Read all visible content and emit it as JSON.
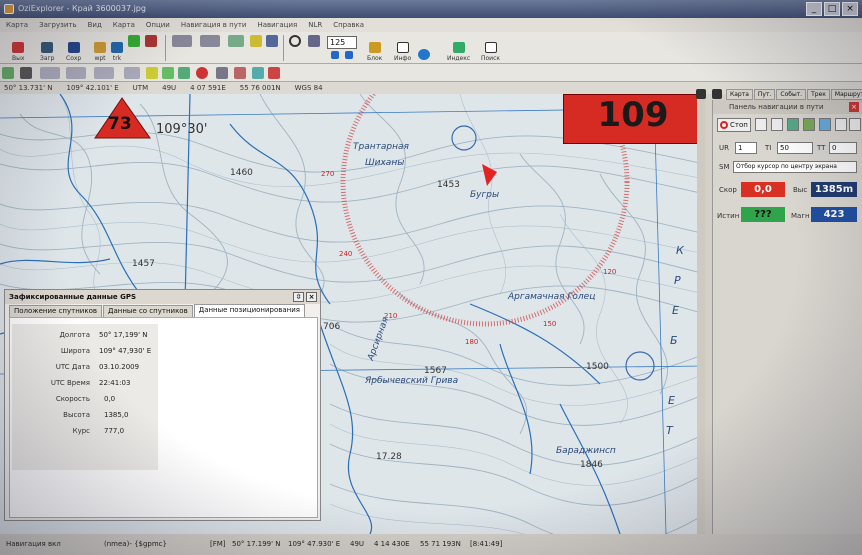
{
  "window": {
    "title": "OziExplorer - Край 3600037.jpg"
  },
  "menu": [
    "Карта",
    "Загрузить",
    "Вид",
    "Карта",
    "Опции",
    "Навигация в пути",
    "Навигация",
    "NLR",
    "Справка"
  ],
  "toolbar1": {
    "buttons": [
      "Вых",
      "Загр",
      "Сохр",
      "wpt",
      "trk",
      "",
      "",
      "Блок",
      "Инфо",
      "",
      "Индекс",
      "Поиск"
    ],
    "zoom": "125"
  },
  "coords": [
    "50° 13.731' N",
    "109° 42.101' E",
    "UTM",
    "49U",
    "4 07 591E",
    "55 76 001N",
    "WGS 84"
  ],
  "map": {
    "markers": {
      "hex_label": "73",
      "box_label": "109"
    },
    "labels": [
      "109°30'",
      "1460",
      "1457",
      "1453",
      "706",
      "1567",
      "17.28",
      "1846",
      "1500"
    ],
    "place_labels": [
      "Трантарная",
      "Шиханы",
      "Бугры",
      "Арсирная",
      "Аргамачная Голец",
      "Ярбычевский Грива",
      "Бараджинсп"
    ],
    "red_labels": [
      "270",
      "240",
      "210",
      "180",
      "150",
      "120"
    ],
    "side_letters": [
      "К",
      "Р",
      "Е",
      "Б",
      "Е",
      "Т"
    ]
  },
  "gps": {
    "title": "Зафиксированные данные GPS",
    "tabs": [
      "Положение спутников",
      "Данные со спутников",
      "Данные позиционирования"
    ],
    "rows": [
      {
        "label": "Долгота",
        "value": "50° 17,199' N"
      },
      {
        "label": "Широта",
        "value": "109° 47,930' E"
      },
      {
        "label": "UTC Дата",
        "value": "03.10.2009"
      },
      {
        "label": "UTC Время",
        "value": "22:41:03"
      },
      {
        "label": "Скорость",
        "value": "0,0"
      },
      {
        "label": "Высота",
        "value": "1385,0"
      },
      {
        "label": "Курс",
        "value": "777,0"
      }
    ]
  },
  "nav": {
    "tabs": [
      "Карта",
      "Пут. точ.",
      "Событ.",
      "Трек",
      "Маршрут"
    ],
    "title": "Панель навигации в пути",
    "stop_label": "Стоп",
    "ur_label": "UR",
    "ur_value": "1",
    "ti_label": "TI",
    "ti_value": "50",
    "tt_label": "TT",
    "tt_value": "0",
    "sm_label": "SM",
    "sm_value": "Отбор курсор по центру экрана",
    "speed_label": "Скор",
    "speed_value": "0,0",
    "alt_label": "Выс",
    "alt_value": "1385m",
    "true_label": "Истин",
    "true_value": "???",
    "mag_label": "Магн",
    "mag_value": "423",
    "colors": {
      "speed": "#d93024",
      "alt": "#1f3a6e",
      "true": "#2fa44a",
      "mag": "#1f4ea0"
    }
  },
  "status": {
    "left": "Навигация вкл",
    "nmea": "(nmea)- {$gpmc}",
    "fm": "[FM]",
    "lat": "50° 17.199' N",
    "lon": "109° 47.930' E",
    "zone": "49U",
    "east": "4 14 430E",
    "north": "55 71 193N",
    "time": "[8:41:49]"
  }
}
